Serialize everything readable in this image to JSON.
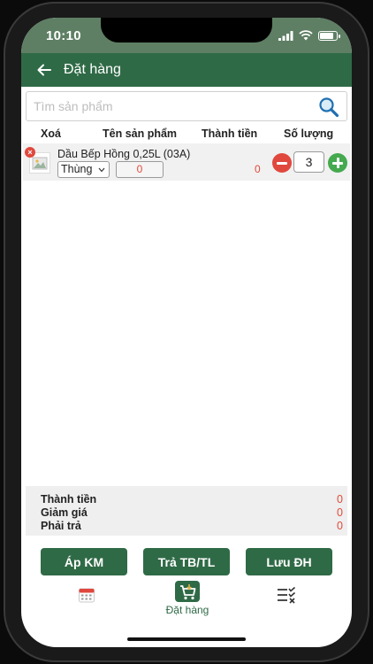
{
  "status_bar": {
    "time": "10:10"
  },
  "header": {
    "title": "Đặt hàng"
  },
  "search": {
    "placeholder": "Tìm sản phẩm"
  },
  "table": {
    "columns": [
      "Xoá",
      "Tên sản phẩm",
      "Thành tiền",
      "Số lượng"
    ]
  },
  "items": [
    {
      "name": "Dầu Bếp Hồng 0,25L (03A)",
      "unit": "Thùng",
      "price": "0",
      "total": "0",
      "quantity": "3"
    }
  ],
  "totals": {
    "subtotal_label": "Thành tiền",
    "subtotal_value": "0",
    "discount_label": "Giảm giá",
    "discount_value": "0",
    "payable_label": "Phải trả",
    "payable_value": "0"
  },
  "actions": {
    "promo": "Áp KM",
    "return": "Trả TB/TL",
    "save": "Lưu ĐH"
  },
  "tabs": [
    {
      "icon": "calendar-icon",
      "label": ""
    },
    {
      "icon": "cart-icon",
      "label": "Đặt hàng"
    },
    {
      "icon": "checklist-icon",
      "label": ""
    }
  ],
  "colors": {
    "primary": "#2f6a46",
    "status_bar": "#5e7f64",
    "danger": "#e0483e",
    "success": "#45a94f",
    "value_text": "#e04a3a"
  }
}
